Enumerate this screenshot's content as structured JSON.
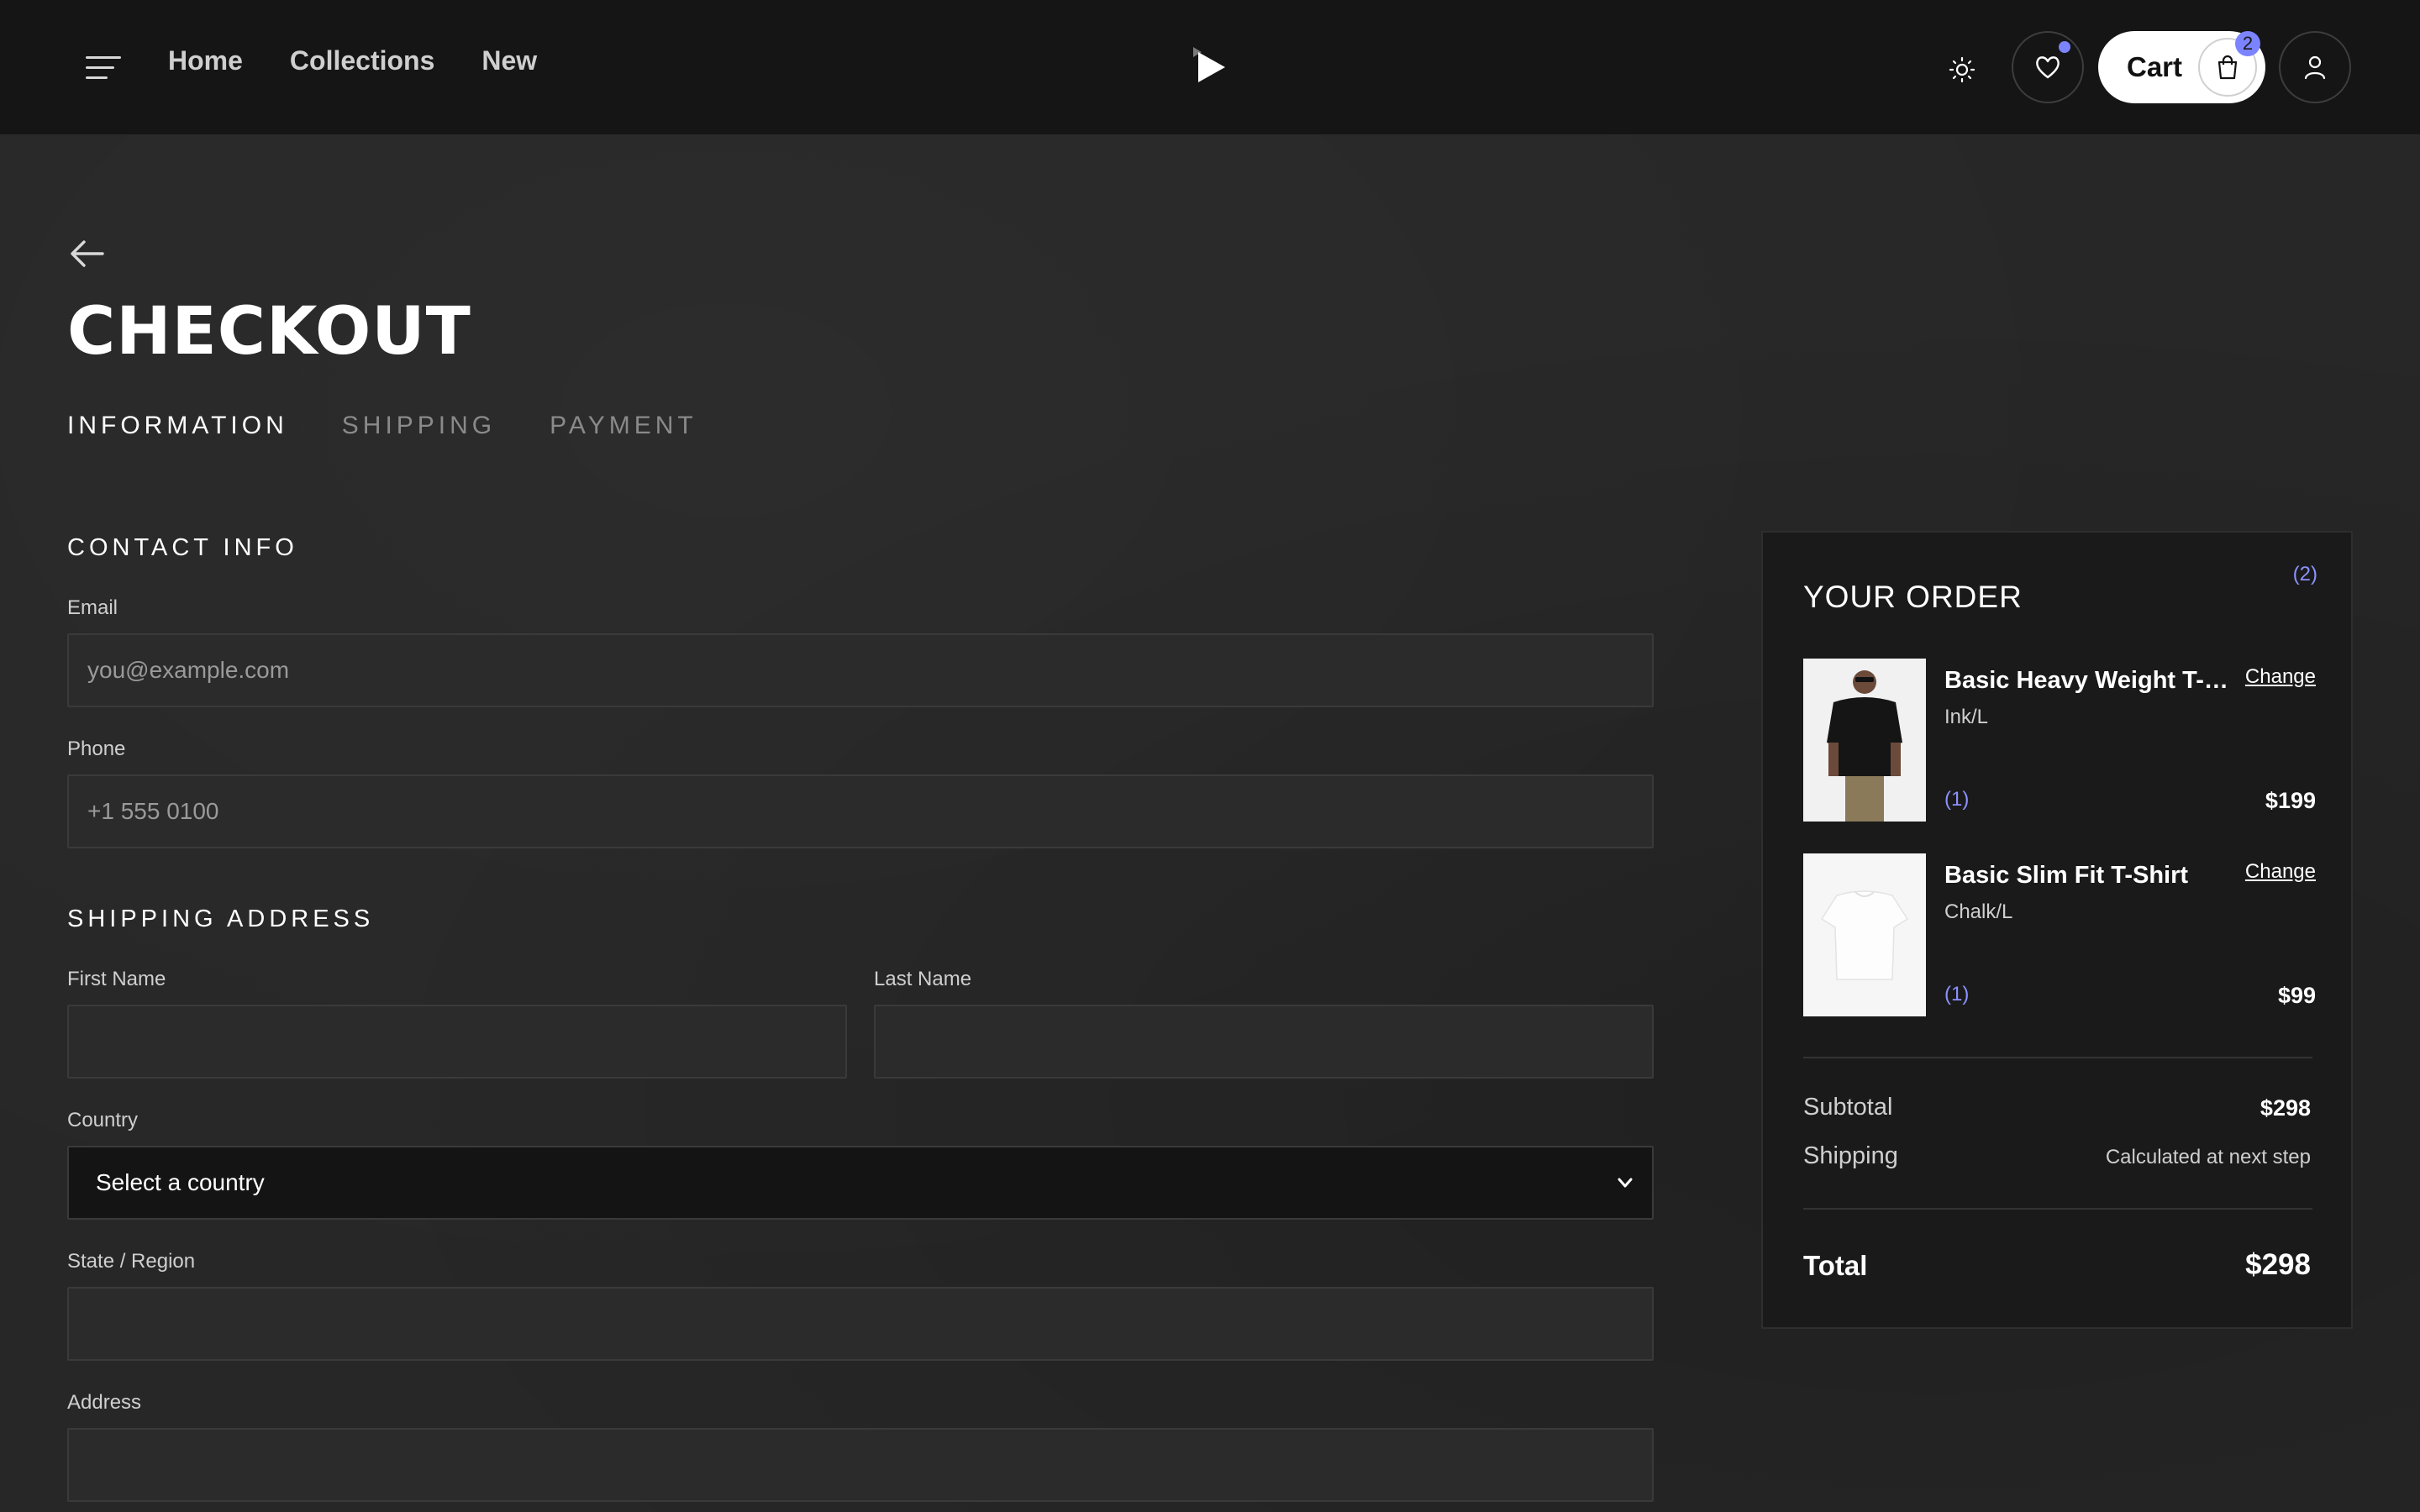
{
  "header": {
    "nav": [
      "Home",
      "Collections",
      "New"
    ],
    "cart_label": "Cart",
    "cart_count": "2"
  },
  "page": {
    "title": "CHECKOUT",
    "steps": [
      "INFORMATION",
      "SHIPPING",
      "PAYMENT"
    ],
    "active_step": "INFORMATION"
  },
  "contact": {
    "heading": "CONTACT INFO",
    "email_label": "Email",
    "email_placeholder": "you@example.com",
    "phone_label": "Phone",
    "phone_placeholder": "+1 555 0100"
  },
  "shipping": {
    "heading": "SHIPPING ADDRESS",
    "first_name_label": "First Name",
    "last_name_label": "Last Name",
    "country_label": "Country",
    "country_value": "Select a country",
    "state_label": "State / Region",
    "address_label": "Address"
  },
  "order": {
    "title": "YOUR ORDER",
    "count": "(2)",
    "items": [
      {
        "name": "Basic Heavy Weight T-Shirt",
        "variant": "Ink/L",
        "qty": "(1)",
        "price": "$199",
        "change": "Change",
        "image": "black-tshirt-model"
      },
      {
        "name": "Basic Slim Fit T-Shirt",
        "variant": "Chalk/L",
        "qty": "(1)",
        "price": "$99",
        "change": "Change",
        "image": "white-tshirt"
      }
    ],
    "subtotal_label": "Subtotal",
    "subtotal": "$298",
    "shipping_label": "Shipping",
    "shipping_value": "Calculated at next step",
    "total_label": "Total",
    "total": "$298"
  },
  "colors": {
    "accent": "#7b83ff",
    "background": "#262626",
    "header": "#151515",
    "card": "#1a1a1a"
  }
}
